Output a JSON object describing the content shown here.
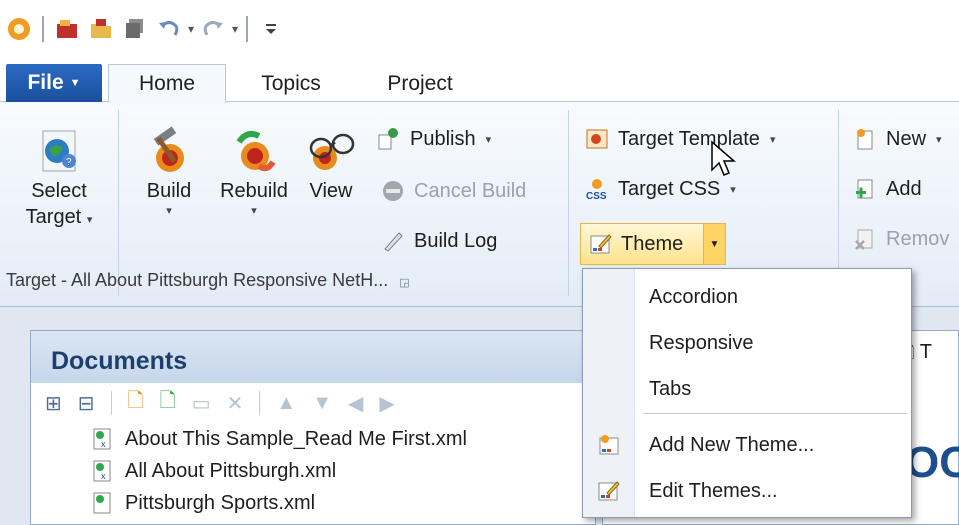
{
  "quick_access": {
    "icons": [
      "app-logo-icon",
      "open-project-icon",
      "open-folder-icon",
      "save-all-icon",
      "undo-icon",
      "redo-icon",
      "customize-qat-icon"
    ]
  },
  "tabs": {
    "file": "File",
    "home": "Home",
    "topics": "Topics",
    "project": "Project"
  },
  "ribbon": {
    "select_target": {
      "line1": "Select",
      "line2": "Target"
    },
    "build": "Build",
    "rebuild": "Rebuild",
    "view": "View",
    "publish": "Publish",
    "cancel_build": "Cancel Build",
    "build_log": "Build Log",
    "target_template": "Target Template",
    "target_css": "Target CSS",
    "theme": "Theme",
    "new": "New",
    "add": "Add",
    "remove": "Remov",
    "group_label": "Target - All About Pittsburgh Responsive NetH..."
  },
  "theme_menu": {
    "items": [
      "Accordion",
      "Responsive",
      "Tabs"
    ],
    "add_new": "Add New Theme...",
    "edit": "Edit Themes..."
  },
  "documents": {
    "title": "Documents",
    "items": [
      "About This Sample_Read Me First.xml",
      "All About Pittsburgh.xml",
      "Pittsburgh Sports.xml"
    ]
  },
  "right_panel": {
    "tab_label": "T",
    "big_text": "OC"
  },
  "colors": {
    "file_tab": "#1b4f9e",
    "theme_highlight": "#ffe28c",
    "doc_title": "#1d3f6e"
  }
}
